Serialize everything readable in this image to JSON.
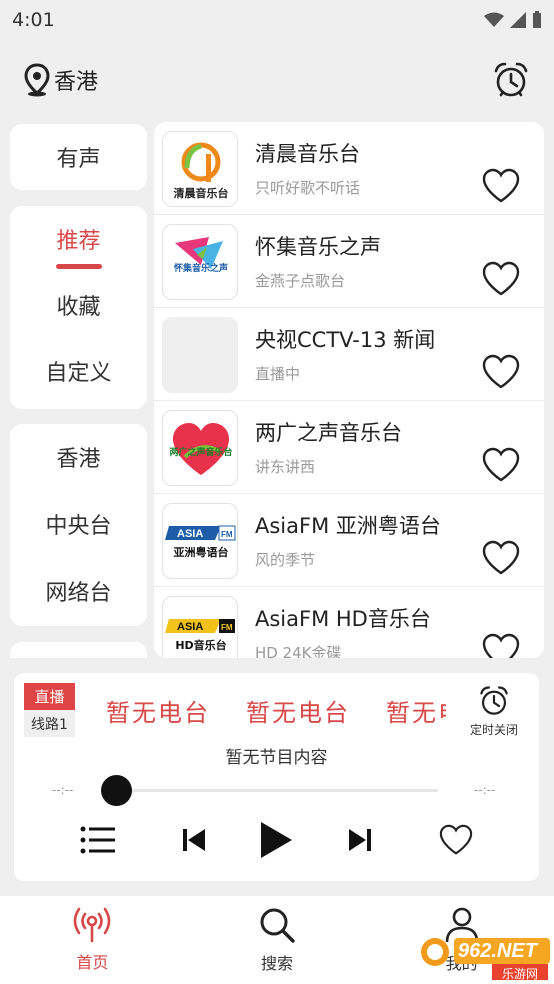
{
  "status_bar": {
    "time": "4:01"
  },
  "header": {
    "location": "香港"
  },
  "left_menu": {
    "group1": [
      "有声"
    ],
    "group2": [
      "推荐",
      "收藏",
      "自定义"
    ],
    "group3": [
      "香港",
      "中央台",
      "网络台"
    ]
  },
  "stations": [
    {
      "name": "清晨音乐台",
      "sub": "只听好歌不听话",
      "logo_text": "清晨音乐台"
    },
    {
      "name": "怀集音乐之声",
      "sub": "金燕子点歌台",
      "logo_text": "怀集音乐之声"
    },
    {
      "name": "央视CCTV-13 新闻",
      "sub": "直播中",
      "logo_text": ""
    },
    {
      "name": "两广之声音乐台",
      "sub": "讲东讲西",
      "logo_text": "两广之声音乐台"
    },
    {
      "name": "AsiaFM 亚洲粤语台",
      "sub": "风的季节",
      "logo_text": "亚洲粤语台"
    },
    {
      "name": "AsiaFM HD音乐台",
      "sub": "HD 24K金碟",
      "logo_text": "HD音乐台"
    }
  ],
  "player": {
    "live_badge": "直播",
    "line_badge": "线路1",
    "marquee": [
      "暂无电台",
      "暂无电台",
      "暂无电台"
    ],
    "timer_label": "定时关闭",
    "program": "暂无节目内容",
    "time_start": "--:--",
    "time_end": "--:--",
    "progress": 0
  },
  "bottom_nav": {
    "home": "首页",
    "search": "搜索",
    "profile": "我的"
  },
  "watermark": {
    "text": "962.NET",
    "sub": "乐游网"
  },
  "colors": {
    "accent": "#d84848",
    "background": "#efefef"
  }
}
